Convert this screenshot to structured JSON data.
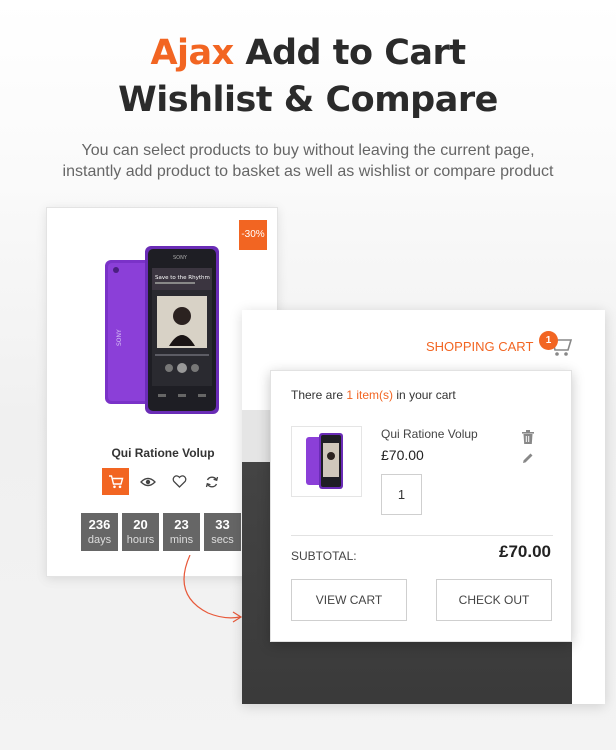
{
  "hero": {
    "title_accent": "Ajax",
    "title_rest": "Add to Cart",
    "title_line2": "Wishlist & Compare",
    "subtitle_line1": "You can select products to buy without leaving the current page,",
    "subtitle_line2": "instantly add product to basket as well as wishlist or compare product"
  },
  "product": {
    "discount": "-30%",
    "name": "Qui Ratione Volup",
    "actions": [
      "cart-icon",
      "eye-icon",
      "heart-icon",
      "refresh-icon"
    ],
    "countdown": [
      {
        "value": "236",
        "unit": "days"
      },
      {
        "value": "20",
        "unit": "hours"
      },
      {
        "value": "23",
        "unit": "mins"
      },
      {
        "value": "33",
        "unit": "secs"
      }
    ],
    "phone_screen_text": "Save to the Rhythm"
  },
  "cart": {
    "label": "SHOPPING CART",
    "count": "1",
    "summary_prefix": "There are",
    "summary_count": "1 item(s)",
    "summary_suffix": "in your cart",
    "item": {
      "name": "Qui Ratione Volup",
      "price": "£70.00",
      "quantity": "1"
    },
    "subtotal_label": "SUBTOTAL:",
    "subtotal_value": "£70.00",
    "view_cart": "VIEW CART",
    "check_out": "CHECK OUT"
  },
  "colors": {
    "accent": "#f26522",
    "countdown_bg": "#666666",
    "text_dark": "#2b2b2b"
  }
}
